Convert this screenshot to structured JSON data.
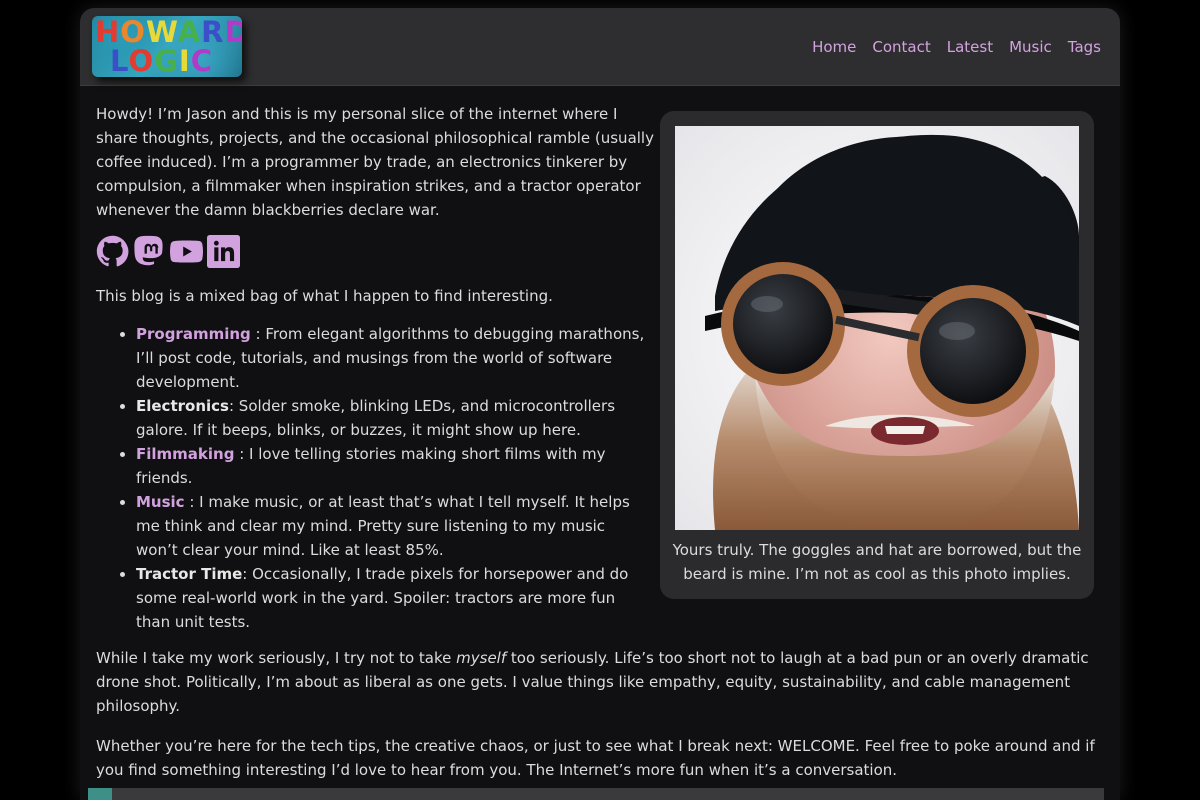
{
  "header": {
    "logo_line1": "HOWARD",
    "logo_line2": "LOGIC",
    "nav": [
      "Home",
      "Contact",
      "Latest",
      "Music",
      "Tags"
    ]
  },
  "intro": "Howdy! I’m Jason and this is my personal slice of the internet where I share thoughts, projects, and the occasional philosophical ramble (usually coffee induced). I’m a programmer by trade, an electronics tinkerer by compulsion, a filmmaker when inspiration strikes, and a tractor operator whenever the damn blackberries declare war.",
  "social_icons": [
    "github-icon",
    "mastodon-icon",
    "youtube-icon",
    "linkedin-icon"
  ],
  "blog_intro": "This blog is a mixed bag of what I happen to find interesting.",
  "topics": [
    {
      "title": "Programming",
      "sep": " : ",
      "text": "From elegant algorithms to debugging marathons, I’ll post code, tutorials, and musings from the world of software development.",
      "link": true
    },
    {
      "title": "Electronics",
      "sep": ": ",
      "text": "Solder smoke, blinking LEDs, and microcontrollers galore. If it beeps, blinks, or buzzes, it might show up here.",
      "link": false
    },
    {
      "title": "Filmmaking",
      "sep": " : ",
      "text": "I love telling stories making short films with my friends.",
      "link": true
    },
    {
      "title": "Music",
      "sep": " : ",
      "text": "I make music, or at least that’s what I tell myself. It helps me think and clear my mind. Pretty sure listening to my music won’t clear your mind. Like at least 85%.",
      "link": true
    },
    {
      "title": "Tractor Time",
      "sep": ": ",
      "text": "Occasionally, I trade pixels for horsepower and do some real-world work in the yard. Spoiler: tractors are more fun than unit tests.",
      "link": false
    }
  ],
  "para1": {
    "before": "While I take my work seriously, I try not to take ",
    "emph": "myself",
    "after": " too seriously. Life’s too short not to laugh at a bad pun or an overly dramatic drone shot. Politically, I’m about as liberal as one gets. I value things like empathy, equity, sustainability, and cable management philosophy."
  },
  "para2": "Whether you’re here for the tech tips, the creative chaos, or just to see what I break next: WELCOME. Feel free to poke around and if you find something interesting I’d love to hear from you. The Internet’s more fun when it’s a conversation.",
  "figure": {
    "caption": "Yours truly. The goggles and hat are borrowed, but the beard is mine. I’m not as cool as this photo implies."
  },
  "colors": {
    "accent": "#d2a2df",
    "background": "#101012",
    "header": "#2e2e30",
    "card": "#2b2b2d"
  }
}
